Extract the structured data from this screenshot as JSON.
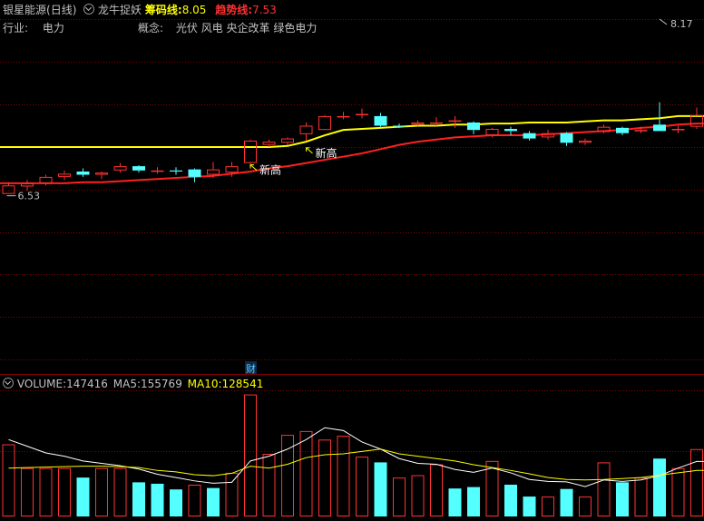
{
  "header": {
    "stock_name": "银星能源",
    "period": "(日线)",
    "indicator_icon": "chevron-down-icon",
    "indicator_name": "龙牛捉妖",
    "chip_label": "筹码线:",
    "chip_value": "8.05",
    "trend_label": "趋势线:",
    "trend_value": "7.53"
  },
  "info": {
    "industry_label": "行业:",
    "industry_value": "电力",
    "concept_label": "概念:",
    "concept_value": "光伏 风电 央企改革 绿色电力"
  },
  "volume_header": {
    "icon": "chevron-down-icon",
    "volume_label": "VOLUME:",
    "volume_value": "147416",
    "ma5_label": "MA5:",
    "ma5_value": "155769",
    "ma10_label": "MA10:",
    "ma10_value": "128541"
  },
  "colors": {
    "background": "#000000",
    "up": "#ff3232",
    "down": "#54ffff",
    "grid": "#800000",
    "chip_line": "#ffff00",
    "trend_line": "#ff2020",
    "volume_ma5": "#ffffff",
    "volume_ma10": "#ffff00",
    "text": "#c0c0c0",
    "annotation": "#ffff00"
  },
  "chart_data": [
    {
      "type": "candlestick",
      "title": "",
      "x": [
        1,
        2,
        3,
        4,
        5,
        6,
        7,
        8,
        9,
        10,
        11,
        12,
        13,
        14,
        15,
        16,
        17,
        18,
        19,
        20,
        21,
        22,
        23,
        24,
        25,
        26,
        27,
        28,
        29,
        30,
        31,
        32,
        33,
        34,
        35,
        36,
        37,
        38
      ],
      "ohlc": [
        {
          "o": 6.53,
          "h": 6.64,
          "l": 6.53,
          "c": 6.61
        },
        {
          "o": 6.6,
          "h": 6.66,
          "l": 6.56,
          "c": 6.63
        },
        {
          "o": 6.63,
          "h": 6.71,
          "l": 6.61,
          "c": 6.69
        },
        {
          "o": 6.69,
          "h": 6.75,
          "l": 6.66,
          "c": 6.72
        },
        {
          "o": 6.74,
          "h": 6.77,
          "l": 6.69,
          "c": 6.71
        },
        {
          "o": 6.71,
          "h": 6.74,
          "l": 6.67,
          "c": 6.73
        },
        {
          "o": 6.75,
          "h": 6.82,
          "l": 6.73,
          "c": 6.79
        },
        {
          "o": 6.79,
          "h": 6.8,
          "l": 6.73,
          "c": 6.75
        },
        {
          "o": 6.75,
          "h": 6.78,
          "l": 6.72,
          "c": 6.75
        },
        {
          "o": 6.75,
          "h": 6.78,
          "l": 6.71,
          "c": 6.74
        },
        {
          "o": 6.76,
          "h": 6.77,
          "l": 6.64,
          "c": 6.69
        },
        {
          "o": 6.71,
          "h": 6.83,
          "l": 6.68,
          "c": 6.76
        },
        {
          "o": 6.73,
          "h": 6.83,
          "l": 6.69,
          "c": 6.79
        },
        {
          "o": 6.82,
          "h": 7.04,
          "l": 6.79,
          "c": 7.03
        },
        {
          "o": 6.99,
          "h": 7.04,
          "l": 6.97,
          "c": 7.02
        },
        {
          "o": 7.01,
          "h": 7.06,
          "l": 6.99,
          "c": 7.05
        },
        {
          "o": 7.09,
          "h": 7.2,
          "l": 7.03,
          "c": 7.17
        },
        {
          "o": 7.13,
          "h": 7.27,
          "l": 7.13,
          "c": 7.26
        },
        {
          "o": 7.25,
          "h": 7.3,
          "l": 7.23,
          "c": 7.26
        },
        {
          "o": 7.27,
          "h": 7.33,
          "l": 7.24,
          "c": 7.28
        },
        {
          "o": 7.26,
          "h": 7.29,
          "l": 7.16,
          "c": 7.17
        },
        {
          "o": 7.17,
          "h": 7.19,
          "l": 7.15,
          "c": 7.16
        },
        {
          "o": 7.18,
          "h": 7.22,
          "l": 7.17,
          "c": 7.2
        },
        {
          "o": 7.19,
          "h": 7.25,
          "l": 7.17,
          "c": 7.2
        },
        {
          "o": 7.21,
          "h": 7.26,
          "l": 7.15,
          "c": 7.22
        },
        {
          "o": 7.2,
          "h": 7.21,
          "l": 7.09,
          "c": 7.13
        },
        {
          "o": 7.08,
          "h": 7.15,
          "l": 7.06,
          "c": 7.14
        },
        {
          "o": 7.14,
          "h": 7.16,
          "l": 7.08,
          "c": 7.12
        },
        {
          "o": 7.1,
          "h": 7.12,
          "l": 7.03,
          "c": 7.05
        },
        {
          "o": 7.06,
          "h": 7.13,
          "l": 7.04,
          "c": 7.1
        },
        {
          "o": 7.1,
          "h": 7.11,
          "l": 6.98,
          "c": 7.01
        },
        {
          "o": 7.01,
          "h": 7.05,
          "l": 6.99,
          "c": 7.03
        },
        {
          "o": 7.11,
          "h": 7.18,
          "l": 7.1,
          "c": 7.16
        },
        {
          "o": 7.15,
          "h": 7.16,
          "l": 7.08,
          "c": 7.1
        },
        {
          "o": 7.12,
          "h": 7.16,
          "l": 7.1,
          "c": 7.13
        },
        {
          "o": 7.18,
          "h": 7.39,
          "l": 7.12,
          "c": 7.12
        },
        {
          "o": 7.13,
          "h": 7.17,
          "l": 7.1,
          "c": 7.14
        },
        {
          "o": 7.16,
          "h": 7.34,
          "l": 7.14,
          "c": 7.27
        }
      ],
      "series": [
        {
          "name": "筹码线",
          "values": [
            6.97,
            6.97,
            6.97,
            6.97,
            6.97,
            6.97,
            6.97,
            6.97,
            6.97,
            6.97,
            6.97,
            6.97,
            6.97,
            6.97,
            6.97,
            6.98,
            7.02,
            7.08,
            7.13,
            7.14,
            7.15,
            7.16,
            7.17,
            7.17,
            7.18,
            7.18,
            7.19,
            7.19,
            7.2,
            7.2,
            7.2,
            7.21,
            7.22,
            7.22,
            7.23,
            7.24,
            7.26,
            7.26
          ]
        },
        {
          "name": "趋势线",
          "values": [
            6.63,
            6.63,
            6.63,
            6.63,
            6.64,
            6.64,
            6.65,
            6.66,
            6.67,
            6.68,
            6.69,
            6.7,
            6.72,
            6.74,
            6.77,
            6.79,
            6.82,
            6.85,
            6.88,
            6.91,
            6.95,
            6.99,
            7.02,
            7.04,
            7.06,
            7.07,
            7.08,
            7.08,
            7.08,
            7.09,
            7.1,
            7.11,
            7.12,
            7.13,
            7.15,
            7.16,
            7.18,
            7.19
          ]
        }
      ],
      "ylim": [
        5.71,
        8.17
      ],
      "annotations": [
        {
          "text": "8.17",
          "x": 36,
          "y": 8.17,
          "marker": "high"
        },
        {
          "text": "6.53",
          "x": 1,
          "y": 6.53,
          "marker": "low"
        },
        {
          "text": "新高",
          "x": 14,
          "y": 6.76
        },
        {
          "text": "新高",
          "x": 17,
          "y": 6.92
        }
      ],
      "event_marker": {
        "text": "财",
        "x": 14
      },
      "grid": true
    },
    {
      "type": "bar",
      "title": "VOLUME",
      "x": [
        1,
        2,
        3,
        4,
        5,
        6,
        7,
        8,
        9,
        10,
        11,
        12,
        13,
        14,
        15,
        16,
        17,
        18,
        19,
        20,
        21,
        22,
        23,
        24,
        25,
        26,
        27,
        28,
        29,
        30,
        31,
        32,
        33,
        34,
        35,
        36,
        37,
        38
      ],
      "values": [
        150000,
        100000,
        100000,
        100000,
        80000,
        100000,
        100000,
        70000,
        67000,
        55000,
        65000,
        58000,
        90000,
        255000,
        130000,
        170000,
        178000,
        160000,
        168000,
        124000,
        112000,
        80000,
        85000,
        108000,
        57000,
        60000,
        115000,
        65000,
        40000,
        40000,
        56000,
        40000,
        112000,
        70000,
        80000,
        120000,
        100000,
        140000
      ],
      "direction": [
        "up",
        "up",
        "up",
        "up",
        "down",
        "up",
        "up",
        "down",
        "down",
        "down",
        "up",
        "down",
        "up",
        "up",
        "up",
        "up",
        "up",
        "up",
        "up",
        "up",
        "down",
        "up",
        "up",
        "up",
        "down",
        "down",
        "up",
        "down",
        "down",
        "up",
        "down",
        "up",
        "up",
        "down",
        "up",
        "down",
        "up",
        "up"
      ],
      "series": [
        {
          "name": "MA5",
          "values": [
            160000,
            146000,
            132000,
            125000,
            115000,
            110000,
            105000,
            98000,
            87000,
            80000,
            73000,
            68000,
            70000,
            115000,
            125000,
            140000,
            160000,
            185000,
            179000,
            155000,
            140000,
            120000,
            110000,
            108000,
            97000,
            91000,
            100000,
            90000,
            76000,
            72000,
            71000,
            61000,
            75000,
            72000,
            75000,
            84000,
            100000,
            114000
          ]
        },
        {
          "name": "MA10",
          "values": [
            100000,
            101000,
            102000,
            103000,
            104000,
            104000,
            103000,
            101000,
            95000,
            92000,
            86000,
            84000,
            89000,
            104000,
            100000,
            108000,
            122000,
            128000,
            130000,
            135000,
            140000,
            130000,
            125000,
            120000,
            115000,
            107000,
            101000,
            95000,
            88000,
            80000,
            76000,
            75000,
            76000,
            78000,
            80000,
            85000,
            90000,
            95000
          ]
        }
      ],
      "ylim": [
        0,
        260000
      ],
      "ylabel": "VOLUME"
    }
  ]
}
